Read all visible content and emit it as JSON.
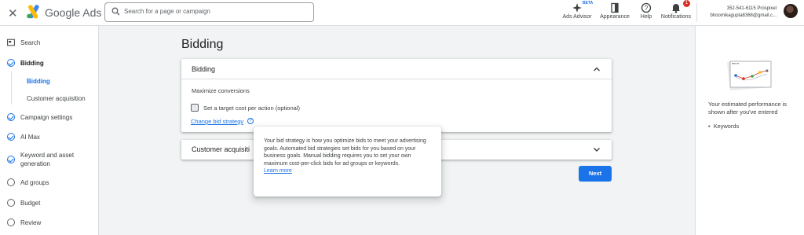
{
  "app": {
    "brand": "Google Ads",
    "close_icon": "close-icon",
    "logo_colors": {
      "blue": "#4285f4",
      "yellow": "#fbbc04",
      "green": "#34a853"
    }
  },
  "search": {
    "placeholder": "Search for a page or campaign",
    "icon": "search-icon"
  },
  "toolbar": {
    "ads_advisor": "Ads Advisor",
    "beta": "BETA",
    "appearance": "Appearance",
    "help": "Help",
    "notifications": "Notifications",
    "notif_count": "1"
  },
  "account": {
    "line1": "352-541-6115 Prospixel",
    "line2": "bhoomikagupta8368@gmail.c..."
  },
  "nav": {
    "search": "Search",
    "bidding": "Bidding",
    "sub_bidding": "Bidding",
    "sub_customer": "Customer acquisition",
    "campaign_settings": "Campaign settings",
    "ai_max": "AI Max",
    "keyword_line1": "Keyword and asset",
    "keyword_line2": "generation",
    "ad_groups": "Ad groups",
    "budget": "Budget",
    "review": "Review"
  },
  "main": {
    "page_title": "Bidding",
    "bidding_card": {
      "title": "Bidding",
      "strategy": "Maximize conversions",
      "checkbox_label": "Set a target cost per action (optional)",
      "checkbox_checked": false,
      "change_link": "Change bid strategy",
      "help_glyph": "?"
    },
    "customer_card": {
      "title": "Customer acquisiti"
    },
    "next_button": "Next"
  },
  "tooltip": {
    "text": "Your bid strategy is how you optimize bids to meet your advertising goals. Automated bid strategies set bids for you based on your business goals. Manual bidding requires you to set your own maximum cost-per-click bids for ad groups or keywords.",
    "link": "Learn more"
  },
  "right_panel": {
    "perf_text": "Your estimated performance is shown after you've entered",
    "bullet": "Keywords"
  },
  "colors": {
    "accent": "#1a73e8",
    "background": "#f1f3f4"
  }
}
